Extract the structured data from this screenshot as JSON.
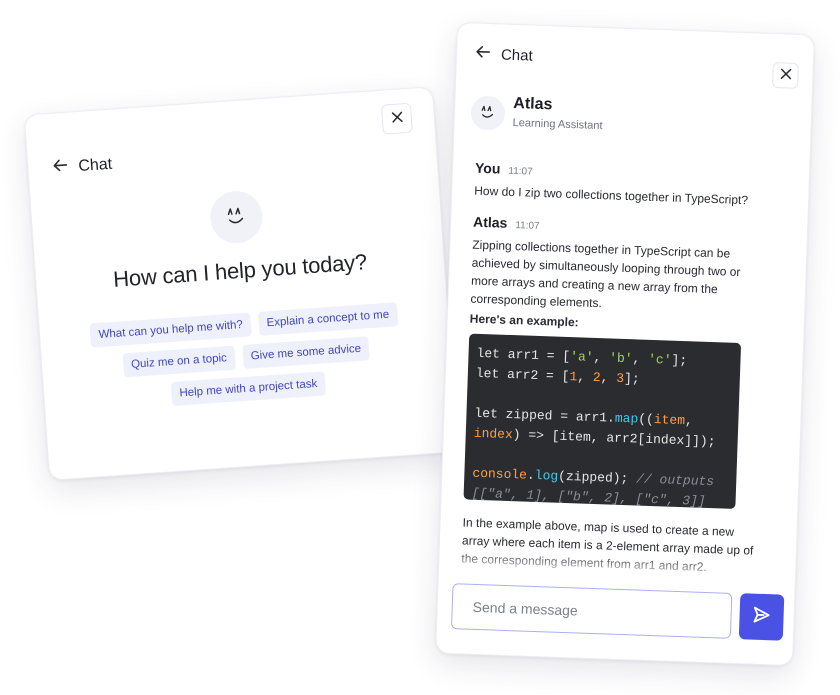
{
  "welcome": {
    "header": {
      "title": "Chat"
    },
    "heading": "How can I help you today?",
    "suggestions": [
      "What can you help me with?",
      "Explain a concept to me",
      "Quiz me on a topic",
      "Give me some advice",
      "Help me with a project task"
    ]
  },
  "chat": {
    "header": {
      "title": "Chat"
    },
    "assistant": {
      "name": "Atlas",
      "role": "Learning Assistant"
    },
    "messages": [
      {
        "author": "You",
        "time": "11:07",
        "text": "How do I zip two collections together in TypeScript?"
      },
      {
        "author": "Atlas",
        "time": "11:07",
        "text": "Zipping collections together in TypeScript can be achieved by simultaneously looping through two or more arrays and creating a new array from the corresponding elements.",
        "example_label": "Here's an example:",
        "code": [
          "let arr1 = ['a', 'b', 'c'];",
          "let arr2 = [1, 2, 3];",
          "",
          "let zipped = arr1.map((item, index) => [item, arr2[index]]);",
          "",
          "console.log(zipped); // outputs [[\"a\", 1], [\"b\", 2], [\"c\", 3]]"
        ],
        "followup": "In the example above, map is used to create a new array where each item is a 2-element array made up of the corresponding element from arr1 and arr2."
      }
    ],
    "composer": {
      "placeholder": "Send a message"
    }
  },
  "colors": {
    "accent": "#4a52e6",
    "chip_bg": "#eef0fc",
    "chip_text": "#4046b8",
    "code_bg": "#2b2c30"
  },
  "icons": [
    "back-arrow-icon",
    "close-icon",
    "atlas-logo-icon",
    "send-icon"
  ]
}
